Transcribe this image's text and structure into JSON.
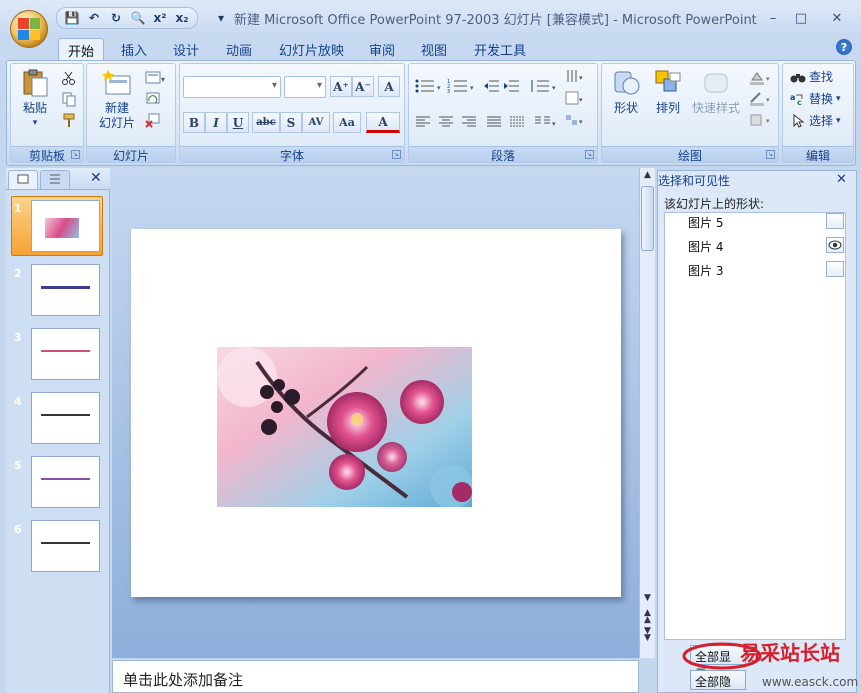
{
  "window": {
    "title": "新建 Microsoft Office PowerPoint 97-2003 幻灯片 [兼容模式] - Microsoft PowerPoint",
    "minimize": "–",
    "maximize": "□",
    "close": "✕"
  },
  "qat": {
    "save": "💾",
    "undo": "↶",
    "redo": "↻",
    "preview": "🔍",
    "superscript": "x²",
    "subscript": "x₂",
    "more": "▾"
  },
  "tabs": [
    "开始",
    "插入",
    "设计",
    "动画",
    "幻灯片放映",
    "审阅",
    "视图",
    "开发工具"
  ],
  "help": "?",
  "ribbon": {
    "clipboard": {
      "paste": "粘贴",
      "paste_arrow": "▾",
      "label": "剪贴板"
    },
    "slides": {
      "new_slide_l1": "新建",
      "new_slide_l2": "幻灯片",
      "new_slide_arrow": "▾",
      "label": "幻灯片"
    },
    "font": {
      "label": "字体",
      "grow": "A⁺",
      "shrink": "A⁻",
      "clear": "A",
      "bold": "B",
      "italic": "I",
      "underline": "U",
      "strike": "abc",
      "shadow": "S",
      "spacing": "AV",
      "case": "Aa",
      "color": "A"
    },
    "paragraph": {
      "label": "段落"
    },
    "drawing": {
      "shapes": "形状",
      "arrange": "排列",
      "quick_styles": "快速样式",
      "label": "绘图"
    },
    "editing": {
      "find": "查找",
      "replace": "替换",
      "select": "选择",
      "label": "编辑"
    }
  },
  "slides_pane": {
    "close": "✕",
    "slides": [
      {
        "num": "1"
      },
      {
        "num": "2"
      },
      {
        "num": "3"
      },
      {
        "num": "4"
      },
      {
        "num": "5"
      },
      {
        "num": "6"
      }
    ],
    "selected_slide": "1"
  },
  "notes": {
    "placeholder": "单击此处添加备注"
  },
  "selection_pane": {
    "title": "选择和可见性",
    "close": "✕",
    "subtitle": "该幻灯片上的形状:",
    "shapes": [
      {
        "name": "图片 5",
        "visible": true
      },
      {
        "name": "图片 4",
        "visible": false
      },
      {
        "name": "图片 3",
        "visible": true
      }
    ],
    "show_all": "全部显示",
    "hide_all": "全部隐藏"
  },
  "watermark": {
    "brand": "易采站长站",
    "url": "www.easck.com"
  },
  "colors": {
    "accent": "#15428b",
    "selected_slide": "#f7a233"
  }
}
